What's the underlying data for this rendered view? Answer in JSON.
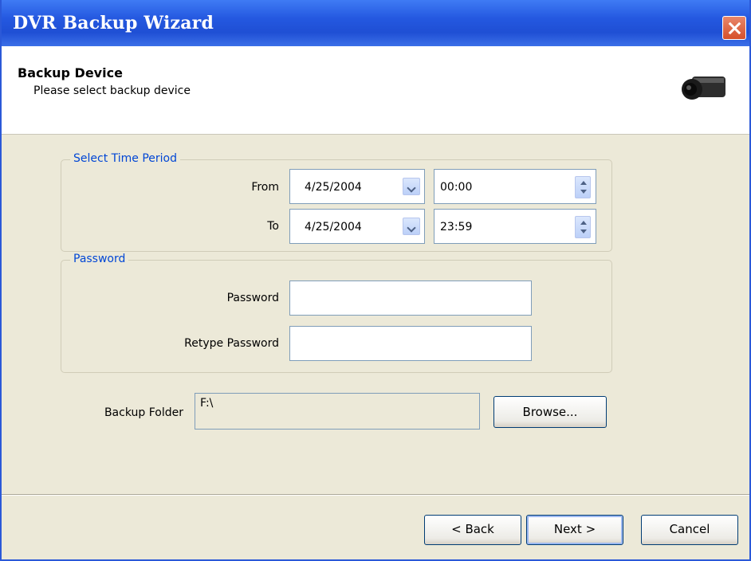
{
  "window": {
    "title": "DVR Backup Wizard"
  },
  "header": {
    "title": "Backup Device",
    "subtitle": "Please select backup device"
  },
  "time_period": {
    "legend": "Select Time Period",
    "from_label": "From",
    "from_date": "4/25/2004",
    "from_time": "00:00",
    "to_label": "To",
    "to_date": "4/25/2004",
    "to_time": "23:59"
  },
  "password": {
    "legend": "Password",
    "password_label": "Password",
    "retype_label": "Retype Password",
    "password_value": "",
    "retype_value": ""
  },
  "backup_folder": {
    "label": "Backup Folder",
    "value": "F:\\",
    "browse_label": "Browse..."
  },
  "footer": {
    "back_label": "< Back",
    "next_label": "Next >",
    "cancel_label": "Cancel"
  },
  "icons": {
    "header_icon": "camera-icon",
    "close": "close-icon"
  },
  "colors": {
    "titlebar": "#245edb",
    "group_legend": "#0046d5",
    "dialog_bg": "#ece9d8"
  }
}
